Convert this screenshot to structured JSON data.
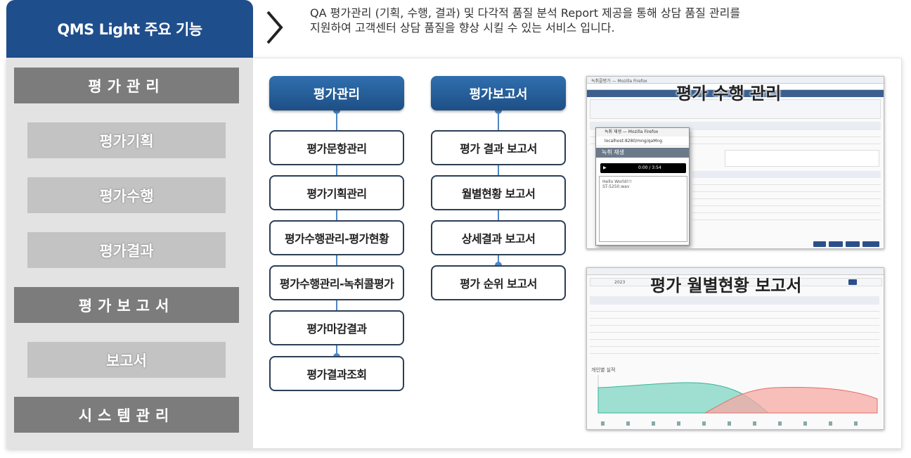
{
  "header": {
    "tab_title": "QMS Light 주요 기능",
    "description_line1": "QA 평가관리 (기획, 수행, 결과) 및 다각적 품질 분석 Report 제공을 통해 상담 품질 관리를",
    "description_line2": "지원하여 고객센터 상담 품질을 향상 시킬 수 있는 서비스 입니다."
  },
  "sidebar": {
    "eval_mgmt": "평가관리",
    "eval_plan": "평가기획",
    "eval_exec": "평가수행",
    "eval_result": "평가결과",
    "eval_report": "평가보고서",
    "report": "보고서",
    "system_mgmt": "시스템관리"
  },
  "flow_left": {
    "head": "평가관리",
    "items": [
      "평가문항관리",
      "평가기획관리",
      "평가수행관리-평가현황",
      "평가수행관리-녹취콜평가",
      "평가마감결과",
      "평가결과조회"
    ]
  },
  "flow_right": {
    "head": "평가보고서",
    "items": [
      "평가 결과 보고서",
      "월별현황 보고서",
      "상세결과 보고서",
      "평가 순위 보고서"
    ]
  },
  "screenshot_top": {
    "title": "평가 수행 관리",
    "window_title": "녹취콜평가 — Mozilla Firefox",
    "popup_title": "녹취 재생 — Mozilla Firefox",
    "popup_url": "localhost:8280/mng/qaMng",
    "popup_header": "녹취 재생",
    "audio_time": "0:00 / 3:54",
    "popup_text1": "Hello World!!!",
    "popup_text2": "ST-5250.wav"
  },
  "screenshot_bottom": {
    "title": "평가 월별현황 보고서",
    "chart_label": "개인별 실적",
    "year": "2023"
  }
}
